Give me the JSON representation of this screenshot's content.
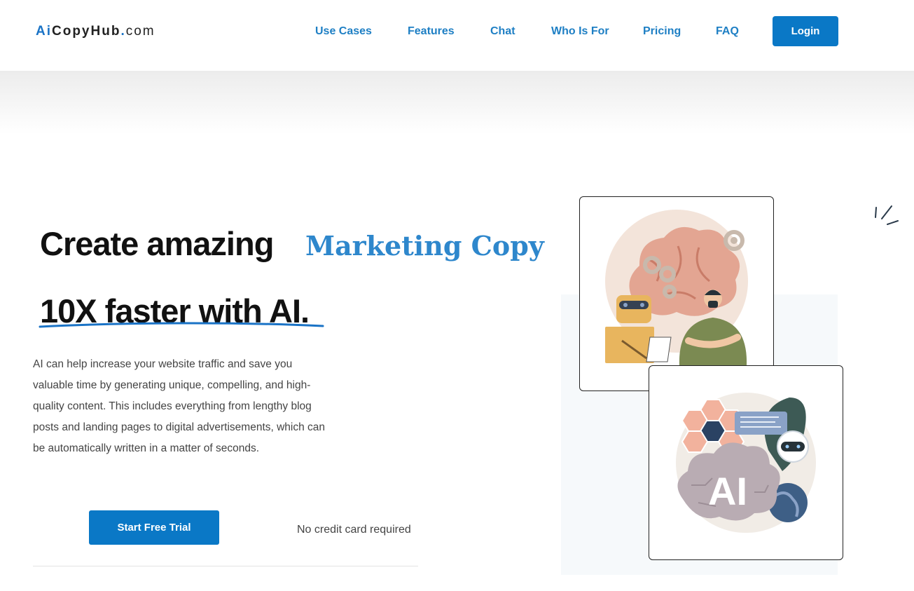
{
  "logo": {
    "ai": "Ai",
    "copyhub": "CopyHub",
    "dot": ".",
    "com": "com"
  },
  "nav": {
    "items": [
      {
        "label": "Use Cases"
      },
      {
        "label": "Features"
      },
      {
        "label": "Chat"
      },
      {
        "label": "Who Is For"
      },
      {
        "label": "Pricing"
      },
      {
        "label": "FAQ"
      }
    ],
    "login_label": "Login"
  },
  "hero": {
    "headline_part1": "Create amazing",
    "headline_highlight": "Marketing Copy",
    "headline_part2": "10X faster with AI.",
    "description": "AI can help increase your website traffic and save you valuable time by generating unique, compelling, and high-quality content. This includes everything from lengthy blog posts and landing pages to digital advertisements, which can be automatically written in a matter of seconds.",
    "cta_label": "Start Free Trial",
    "note": "No credit card required"
  },
  "illustrations": {
    "card2_text": "AI"
  },
  "colors": {
    "accent": "#0a78c6",
    "nav_text": "#1e7fc4",
    "highlight": "#2e87cc"
  }
}
